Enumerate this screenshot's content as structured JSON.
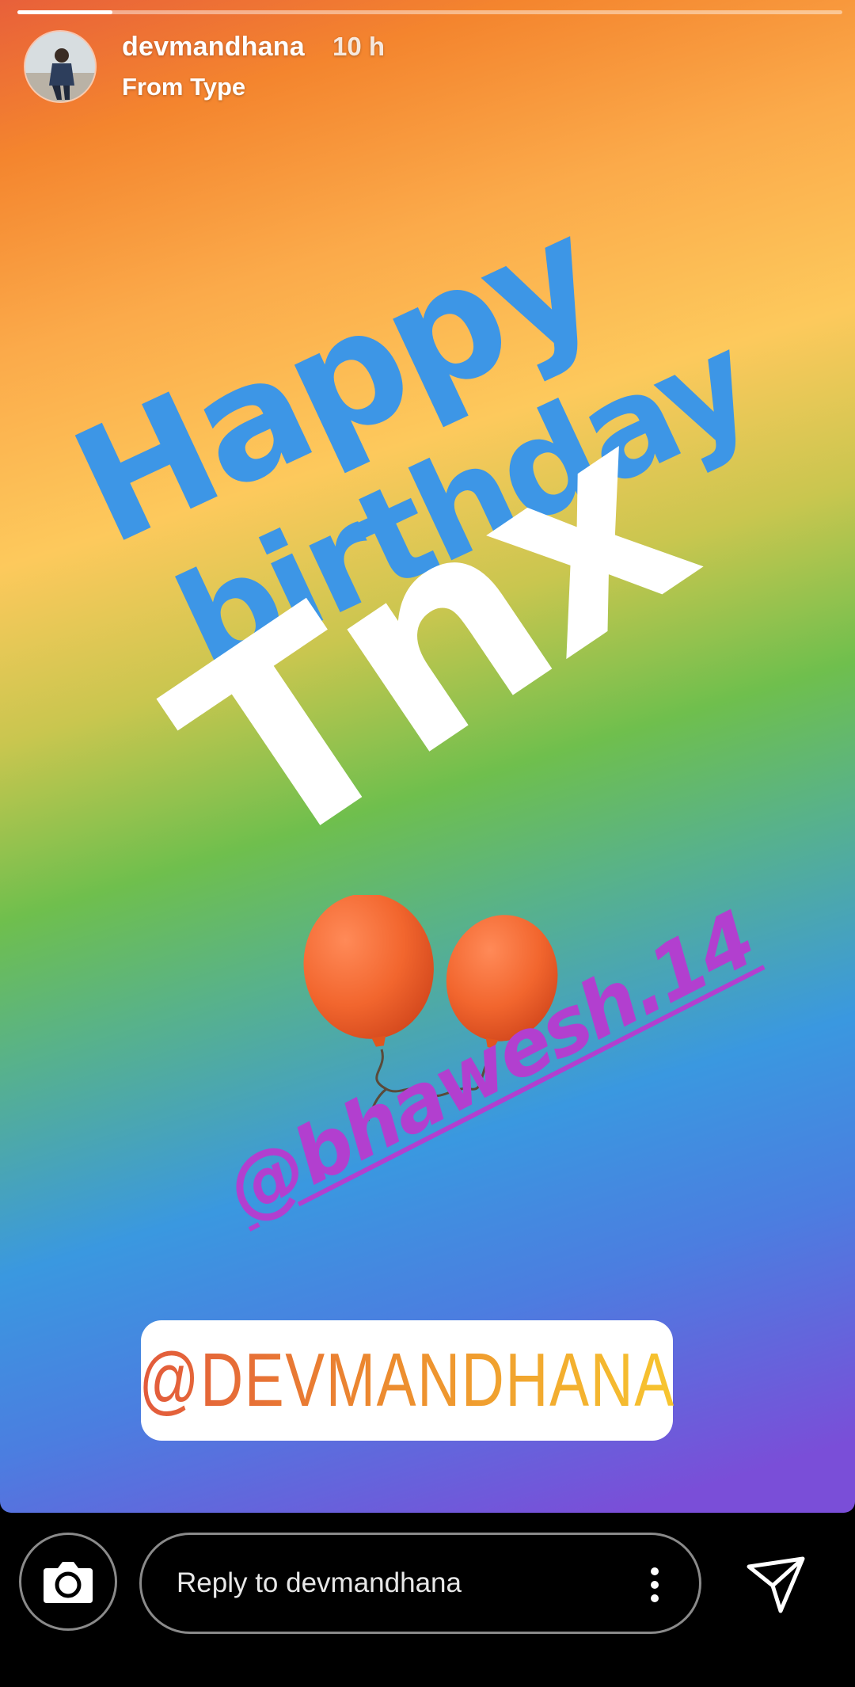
{
  "story": {
    "progress": 0.115,
    "user": {
      "username": "devmandhana",
      "time_ago": "10 h",
      "subtitle": "From Type"
    },
    "text_lines": {
      "line1": "Happy",
      "line2": "birthday",
      "line3": "Tnx"
    },
    "mention_sticker": "@bhawesh.14",
    "tag_sticker": "@DEVMANDHANA",
    "emoji": "balloons"
  },
  "reply_bar": {
    "placeholder": "Reply to devmandhana"
  },
  "icons": {
    "camera": "camera-icon",
    "more": "more-vertical-icon",
    "send": "send-paper-plane-icon"
  },
  "colors": {
    "headline_blue": "#3d96e6",
    "mention_purple": "#b23fcf",
    "tag_gradient_start": "#e25a3c",
    "tag_gradient_end": "#f7c52f"
  }
}
